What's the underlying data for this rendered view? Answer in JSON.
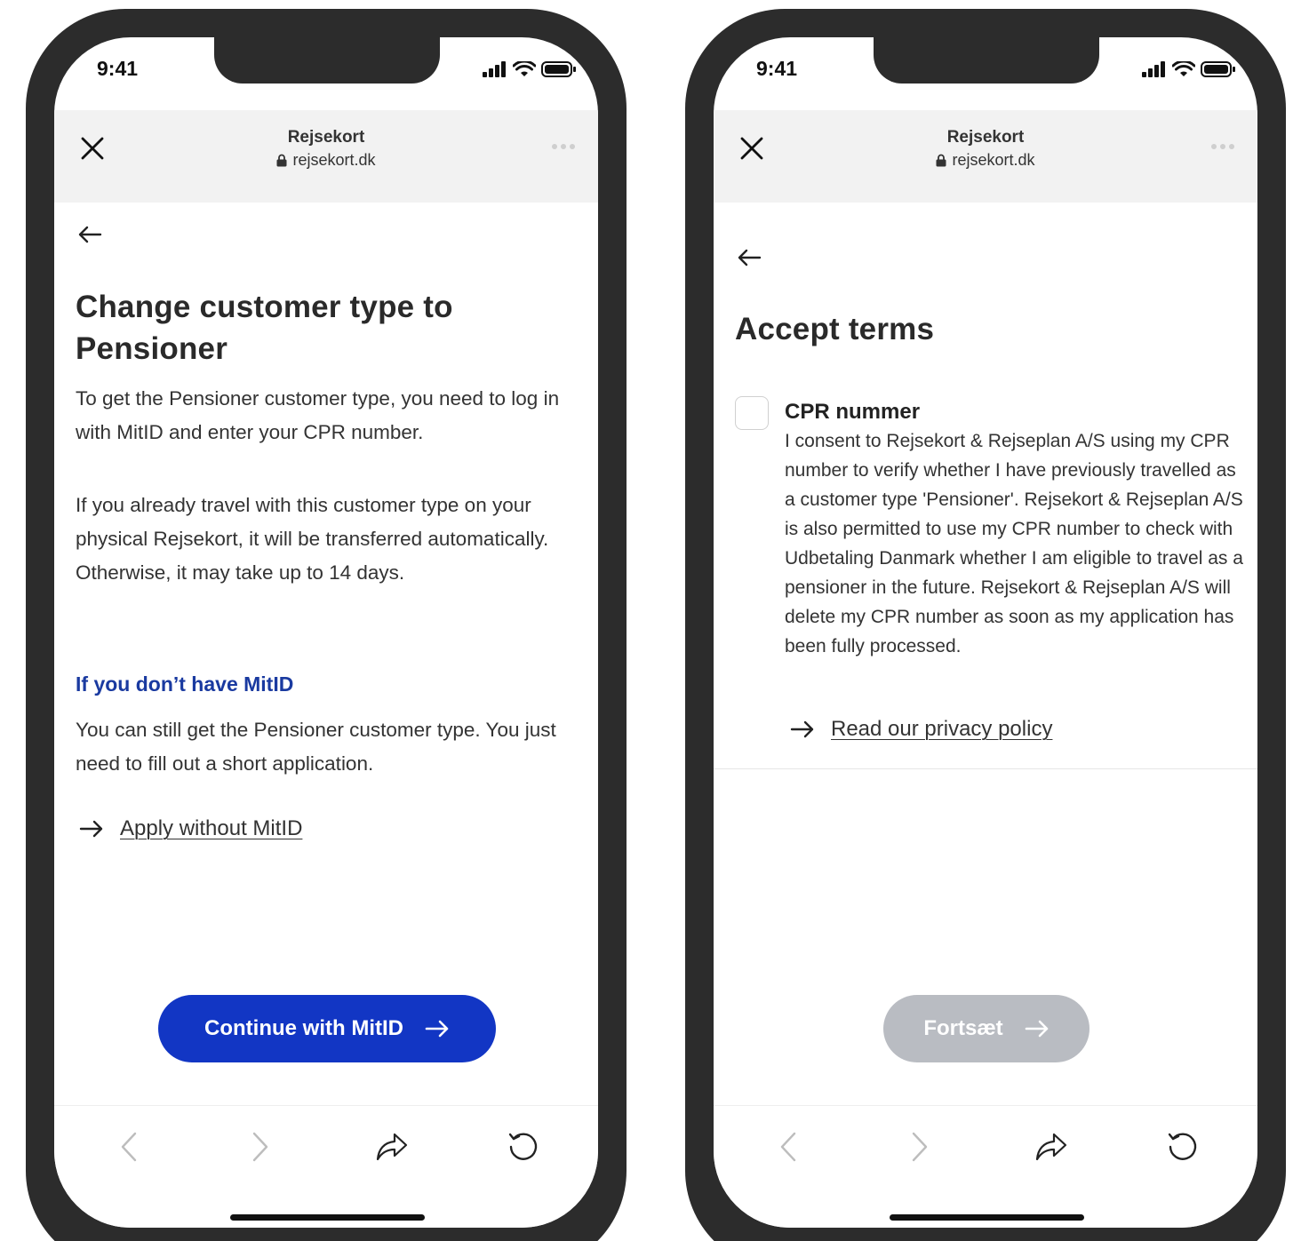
{
  "colors": {
    "primary": "#1236c4",
    "disabled": "#b9bcc2",
    "subheading": "#1a3aa0",
    "frame": "#2c2c2c",
    "browser_bar": "#f2f2f2"
  },
  "status_bar": {
    "time": "9:41"
  },
  "browser": {
    "title": "Rejsekort",
    "url": "rejsekort.dk"
  },
  "left_screen": {
    "heading_line1": "Change customer type to",
    "heading_line2": "Pensioner",
    "intro": "To get the Pensioner customer type, you need to log in with MitID and enter your CPR number.",
    "transfer_text": "If you already travel with this customer type on your physical Rejsekort, it will be transferred automatically. Otherwise, it may take up to 14 days.",
    "no_mitid_heading": "If you don’t have MitID",
    "no_mitid_text": "You can still get the Pensioner customer type. You just need to fill out a short application.",
    "apply_link": "Apply without MitID",
    "continue_button": "Continue with MitID"
  },
  "right_screen": {
    "heading": "Accept terms",
    "checkbox_title": "CPR nummer",
    "checkbox_text": "I consent to Rejsekort & Rejseplan A/S using my CPR number to verify whether I have previously travelled as a customer type 'Pensioner'. Rejsekort & Rejseplan A/S is also permitted to use my CPR number to check with Udbetaling Danmark whether I am eligible to travel as a pensioner in the future. Rejsekort & Rejseplan A/S will delete my CPR number as soon as my application has been fully processed.",
    "checkbox_checked": false,
    "privacy_link": "Read our privacy policy",
    "continue_button": "Fortsæt"
  },
  "icons": {
    "close": "close-icon",
    "lock": "lock-icon",
    "more": "more-dots-icon",
    "back": "arrow-left-icon",
    "arrow_right": "arrow-right-icon",
    "nav_back": "chevron-left-icon",
    "nav_forward": "chevron-right-icon",
    "share": "share-icon",
    "reload": "reload-icon"
  }
}
